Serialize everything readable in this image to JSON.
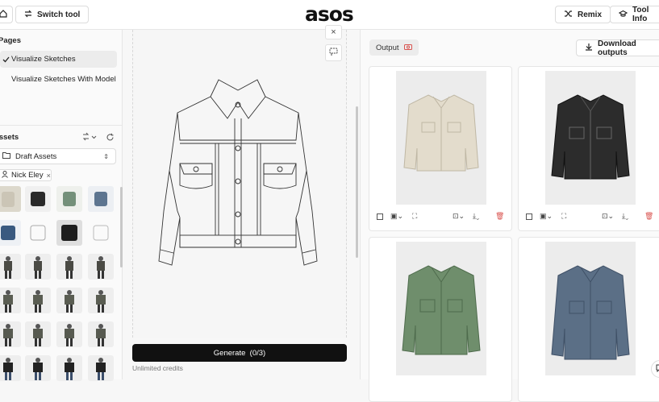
{
  "header": {
    "switch_tool": "Switch tool",
    "logo": "asos",
    "remix": "Remix",
    "tool_info": "Tool Info"
  },
  "sidebar": {
    "pages_title": "Pages",
    "pages": [
      {
        "label": "Visualize Sketches",
        "active": true
      },
      {
        "label": "Visualize Sketches With Model",
        "active": false
      }
    ],
    "assets_title": "Assets",
    "folder": "Draft Assets",
    "filter_chip": "Nick Eley"
  },
  "canvas": {
    "generate_label": "Generate  (0/3)",
    "credits": "Unlimited credits"
  },
  "output": {
    "tab_label": "Output",
    "download_label": "Download outputs",
    "cards": [
      {
        "name": "cream-jacket",
        "color": "#e3dccc"
      },
      {
        "name": "black-leather-jacket",
        "color": "#2c2c2c"
      },
      {
        "name": "green-denim-jacket",
        "color": "#6f8e6c"
      },
      {
        "name": "blue-denim-jacket",
        "color": "#5b6f86"
      }
    ]
  },
  "colors": {
    "primary": "#111111",
    "danger": "#d9534f",
    "border": "#e6e6e6"
  }
}
